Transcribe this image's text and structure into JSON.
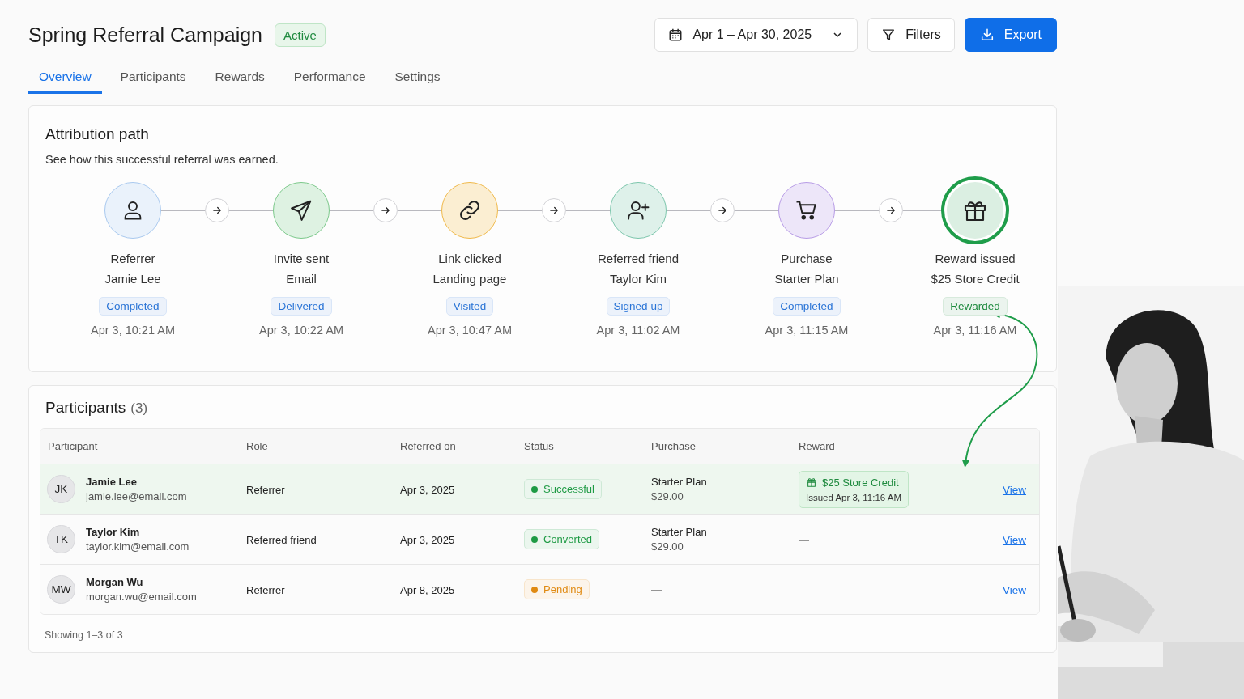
{
  "header": {
    "title": "Spring Referral Campaign",
    "badge": "Active",
    "date_range": "Apr 1 – Apr 30, 2025",
    "filters": "Filters",
    "export": "Export"
  },
  "tabs": [
    {
      "label": "Overview",
      "selected": true
    },
    {
      "label": "Participants",
      "selected": false
    },
    {
      "label": "Rewards",
      "selected": false
    },
    {
      "label": "Performance",
      "selected": false
    },
    {
      "label": "Settings",
      "selected": false
    }
  ],
  "attribution": {
    "title": "Attribution path",
    "subtitle": "See how this successful referral was earned.",
    "steps": [
      {
        "kind": "referrer",
        "color": "#a9c9ef",
        "label": "Referrer",
        "detail": "Jamie Lee",
        "status": {
          "text": "Completed",
          "color": "#2a74d6"
        },
        "time": "Apr 3, 10:21 AM",
        "highlighted": false
      },
      {
        "kind": "invite",
        "color": "#7cc98b",
        "label": "Invite sent",
        "detail": "Email",
        "status": {
          "text": "Delivered",
          "color": "#2a74d6"
        },
        "time": "Apr 3, 10:22 AM",
        "highlighted": false
      },
      {
        "kind": "click",
        "color": "#f0b94a",
        "label": "Link clicked",
        "detail": "Landing page",
        "status": {
          "text": "Visited",
          "color": "#2a74d6"
        },
        "time": "Apr 3, 10:47 AM",
        "highlighted": false
      },
      {
        "kind": "signup",
        "color": "#7cc6ac",
        "label": "Referred friend",
        "detail": "Taylor Kim",
        "status": {
          "text": "Signed up",
          "color": "#2a74d6"
        },
        "time": "Apr 3, 11:02 AM",
        "highlighted": false
      },
      {
        "kind": "purchase",
        "color": "#b79be6",
        "label": "Purchase",
        "detail": "Starter Plan",
        "status": {
          "text": "Completed",
          "color": "#2a74d6"
        },
        "time": "Apr 3, 11:15 AM",
        "highlighted": false
      },
      {
        "kind": "reward",
        "color": "#1f9d4a",
        "label": "Reward issued",
        "detail": "$25 Store Credit",
        "status": {
          "text": "Rewarded",
          "color": "#1e8a3e"
        },
        "time": "Apr 3, 11:16 AM",
        "highlighted": true
      }
    ]
  },
  "participants": {
    "title": "Participants",
    "count": "(3)",
    "columns": [
      "Participant",
      "Role",
      "Referred on",
      "Status",
      "Purchase",
      "Reward"
    ],
    "rows": [
      {
        "initials": "JK",
        "name": "Jamie Lee",
        "email": "jamie.lee@email.com",
        "role": "Referrer",
        "referred_on": "Apr 3, 2025",
        "status": {
          "text": "Successful",
          "color": "#1e9a44"
        },
        "purchase": {
          "plan": "Starter Plan",
          "price": "$29.00"
        },
        "reward": {
          "title": "$25 Store Credit",
          "issued": "Issued Apr 3, 11:16 AM"
        },
        "action": "View",
        "selected": true
      },
      {
        "initials": "TK",
        "name": "Taylor Kim",
        "email": "taylor.kim@email.com",
        "role": "Referred friend",
        "referred_on": "Apr 3, 2025",
        "status": {
          "text": "Converted",
          "color": "#1e9a44"
        },
        "purchase": {
          "plan": "Starter Plan",
          "price": "$29.00"
        },
        "reward": {
          "none": "—"
        },
        "action": "View",
        "selected": false
      },
      {
        "initials": "MW",
        "name": "Morgan Wu",
        "email": "morgan.wu@email.com",
        "role": "Referrer",
        "referred_on": "Apr 8, 2025",
        "status": {
          "text": "Pending",
          "color": "#e08a12"
        },
        "purchase": {
          "none": "—"
        },
        "reward": {
          "none": "—"
        },
        "action": "View",
        "selected": false
      }
    ],
    "footer": "Showing 1–3 of 3"
  }
}
